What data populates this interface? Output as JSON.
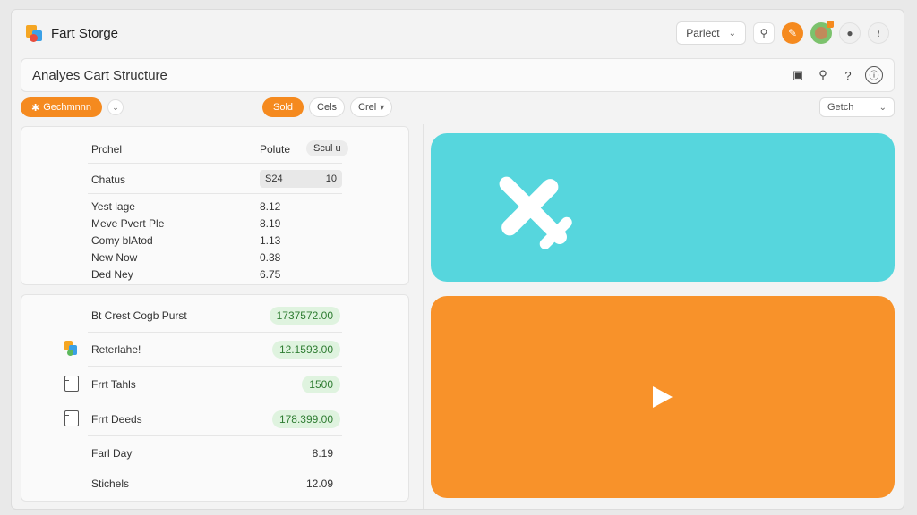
{
  "app": {
    "title": "Fart Storge"
  },
  "appbar": {
    "select_value": "Parlect",
    "avatar_badge_color": "#f58a1f",
    "accent": "#f58a1f"
  },
  "page": {
    "title": "Analyes Cart Structure"
  },
  "toolbar": {
    "primary_button": "Gechmnnn",
    "center_button": "Sold",
    "chip_1": "Cels",
    "chip_2": "Crel",
    "right_select": "Getch"
  },
  "table_top": {
    "header": {
      "label": "Prchel",
      "value": "Polute",
      "pill": "Scul u"
    },
    "status": {
      "label": "Chatus",
      "value_left": "S24",
      "value_right": "10"
    },
    "rows": [
      {
        "label": "Yest lage",
        "value": "8.12"
      },
      {
        "label": "Meve Pvert Ple",
        "value": "8.19"
      },
      {
        "label": "Comy blAtod",
        "value": "1.13"
      },
      {
        "label": "New Now",
        "value": "0.38"
      },
      {
        "label": "Ded Ney",
        "value": "6.75"
      }
    ]
  },
  "table_bottom": {
    "rows": [
      {
        "label": "Bt Crest Cogb Purst",
        "value": "1737572.00",
        "style": "green",
        "icon": "none"
      },
      {
        "label": "Reterlahe!",
        "value": "12.1593.00",
        "style": "green",
        "icon": "app-icon"
      },
      {
        "label": "Frrt Tahls",
        "value": "1500",
        "style": "green",
        "icon": "document-icon"
      },
      {
        "label": "Frrt Deeds",
        "value": "178.399.00",
        "style": "green",
        "icon": "document-icon"
      },
      {
        "label": "Farl Day",
        "value": "8.19",
        "style": "plain",
        "icon": "none"
      },
      {
        "label": "Stichels",
        "value": "12.09",
        "style": "plain",
        "icon": "none"
      }
    ]
  },
  "cards": {
    "top": {
      "color": "#56d6dd",
      "icon": "airplane-icon"
    },
    "bottom": {
      "color": "#f8922a",
      "icon": "play-icon"
    }
  }
}
